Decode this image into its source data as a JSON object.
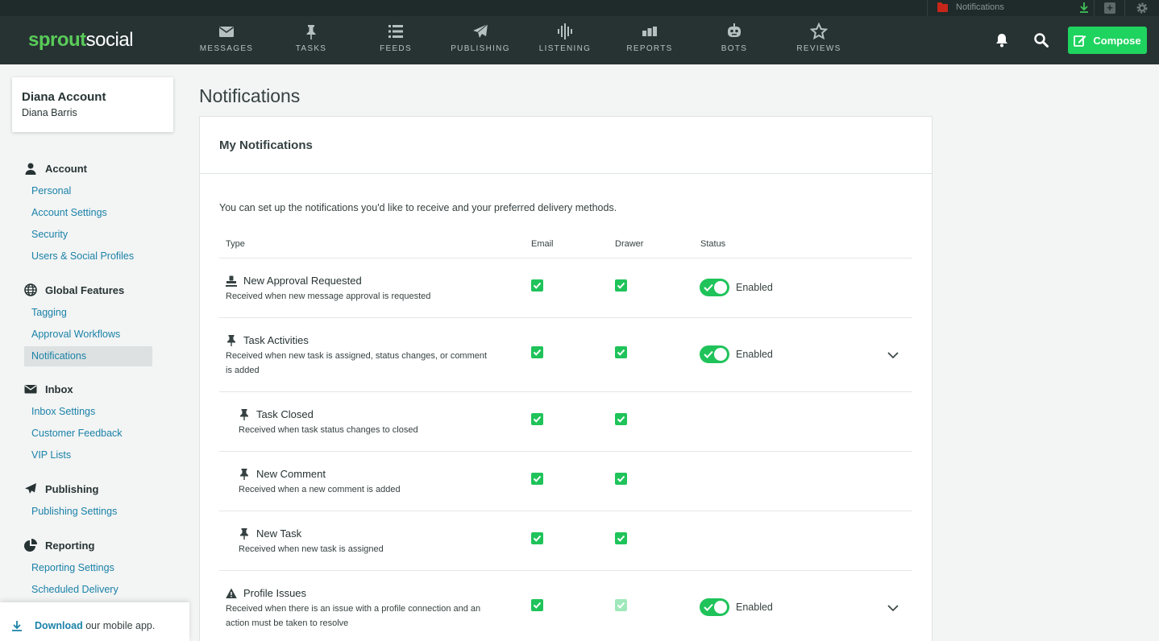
{
  "topbar": {
    "notification_label": "Notifications"
  },
  "brand": {
    "part1": "sprout",
    "part2": "social"
  },
  "nav": {
    "items": [
      {
        "label": "MESSAGES",
        "icon": "envelope-icon"
      },
      {
        "label": "TASKS",
        "icon": "pin-icon"
      },
      {
        "label": "FEEDS",
        "icon": "list-icon"
      },
      {
        "label": "PUBLISHING",
        "icon": "paper-plane-icon"
      },
      {
        "label": "LISTENING",
        "icon": "sound-wave-icon"
      },
      {
        "label": "REPORTS",
        "icon": "bar-chart-icon"
      },
      {
        "label": "BOTS",
        "icon": "robot-icon"
      },
      {
        "label": "REVIEWS",
        "icon": "star-icon"
      }
    ],
    "compose_label": "Compose"
  },
  "account": {
    "name": "Diana Account",
    "user": "Diana Barris"
  },
  "sidebar": {
    "sections": [
      {
        "title": "Account",
        "icon": "user-icon",
        "links": [
          "Personal",
          "Account Settings",
          "Security",
          "Users & Social Profiles"
        ]
      },
      {
        "title": "Global Features",
        "icon": "globe-icon",
        "links": [
          "Tagging",
          "Approval Workflows",
          "Notifications"
        ]
      },
      {
        "title": "Inbox",
        "icon": "envelope-icon",
        "links": [
          "Inbox Settings",
          "Customer Feedback",
          "VIP Lists"
        ]
      },
      {
        "title": "Publishing",
        "icon": "paper-plane-icon",
        "links": [
          "Publishing Settings"
        ]
      },
      {
        "title": "Reporting",
        "icon": "pie-chart-icon",
        "links": [
          "Reporting Settings",
          "Scheduled Delivery"
        ]
      }
    ],
    "active_link": "Notifications",
    "download_link": "Download",
    "download_text": " our mobile app."
  },
  "main": {
    "page_title": "Notifications",
    "panel_title": "My Notifications",
    "intro": "You can set up the notifications you'd like to receive and your preferred delivery methods.",
    "columns": {
      "type": "Type",
      "email": "Email",
      "drawer": "Drawer",
      "status": "Status"
    },
    "rows": [
      {
        "title": "New Approval Requested",
        "icon": "stamp-icon",
        "desc": "Received when new message approval is requested",
        "email": true,
        "drawer": true,
        "status": "Enabled",
        "expandable": false
      },
      {
        "title": "Task Activities",
        "icon": "pin-icon",
        "desc": "Received when new task is assigned, status changes, or comment is added",
        "email": true,
        "drawer": true,
        "status": "Enabled",
        "expandable": true
      },
      {
        "title": "Task Closed",
        "icon": "pin-icon",
        "desc": "Received when task status changes to closed",
        "email": true,
        "drawer": true,
        "child": true
      },
      {
        "title": "New Comment",
        "icon": "pin-icon",
        "desc": "Received when a new comment is added",
        "email": true,
        "drawer": true,
        "child": true
      },
      {
        "title": "New Task",
        "icon": "pin-icon",
        "desc": "Received when new task is assigned",
        "email": true,
        "drawer": true,
        "child": true
      },
      {
        "title": "Profile Issues",
        "icon": "warning-icon",
        "desc": "Received when there is an issue with a profile connection and an action must be taken to resolve",
        "email": true,
        "drawer": true,
        "drawer_disabled": true,
        "status": "Enabled",
        "expandable": true
      }
    ]
  },
  "colors": {
    "nav_bg": "#273333",
    "accent_green": "#1fd35f",
    "link_blue": "#1a82a8"
  }
}
